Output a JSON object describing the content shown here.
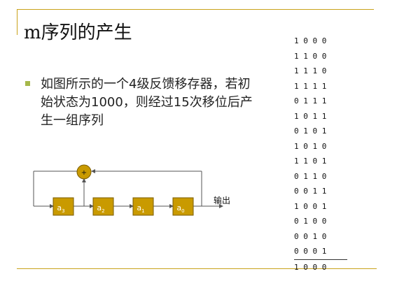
{
  "slide": {
    "title": "m序列的产生",
    "bullet_text": "如图所示的一个4级反馈移存器，若初始状态为1000，则经过15次移位后产生一组序列"
  },
  "diagram": {
    "registers": [
      "a3",
      "a2",
      "a1",
      "a0"
    ],
    "register_labels": [
      {
        "main": "a",
        "sub": "3"
      },
      {
        "main": "a",
        "sub": "2"
      },
      {
        "main": "a",
        "sub": "1"
      },
      {
        "main": "a",
        "sub": "0"
      }
    ],
    "adder_symbol": "+",
    "output_label": "输出"
  },
  "sequence_table": {
    "rows": [
      "1 0 0 0",
      "1 1 0 0",
      "1 1 1 0",
      "1 1 1 1",
      "0 1 1 1",
      "1 0 1 1",
      "0 1 0 1",
      "1 0 1 0",
      "1 1 0 1",
      "0 1 1 0",
      "0 0 1 1",
      "1 0 0 1",
      "0 1 0 0",
      "0 0 1 0",
      "0 0 0 1"
    ],
    "final_row": "1 0 0 0"
  },
  "colors": {
    "accent": "#c9a21a",
    "bullet": "#a6b84a",
    "register_fill": "#c99a00",
    "register_border": "#7a5c00"
  }
}
